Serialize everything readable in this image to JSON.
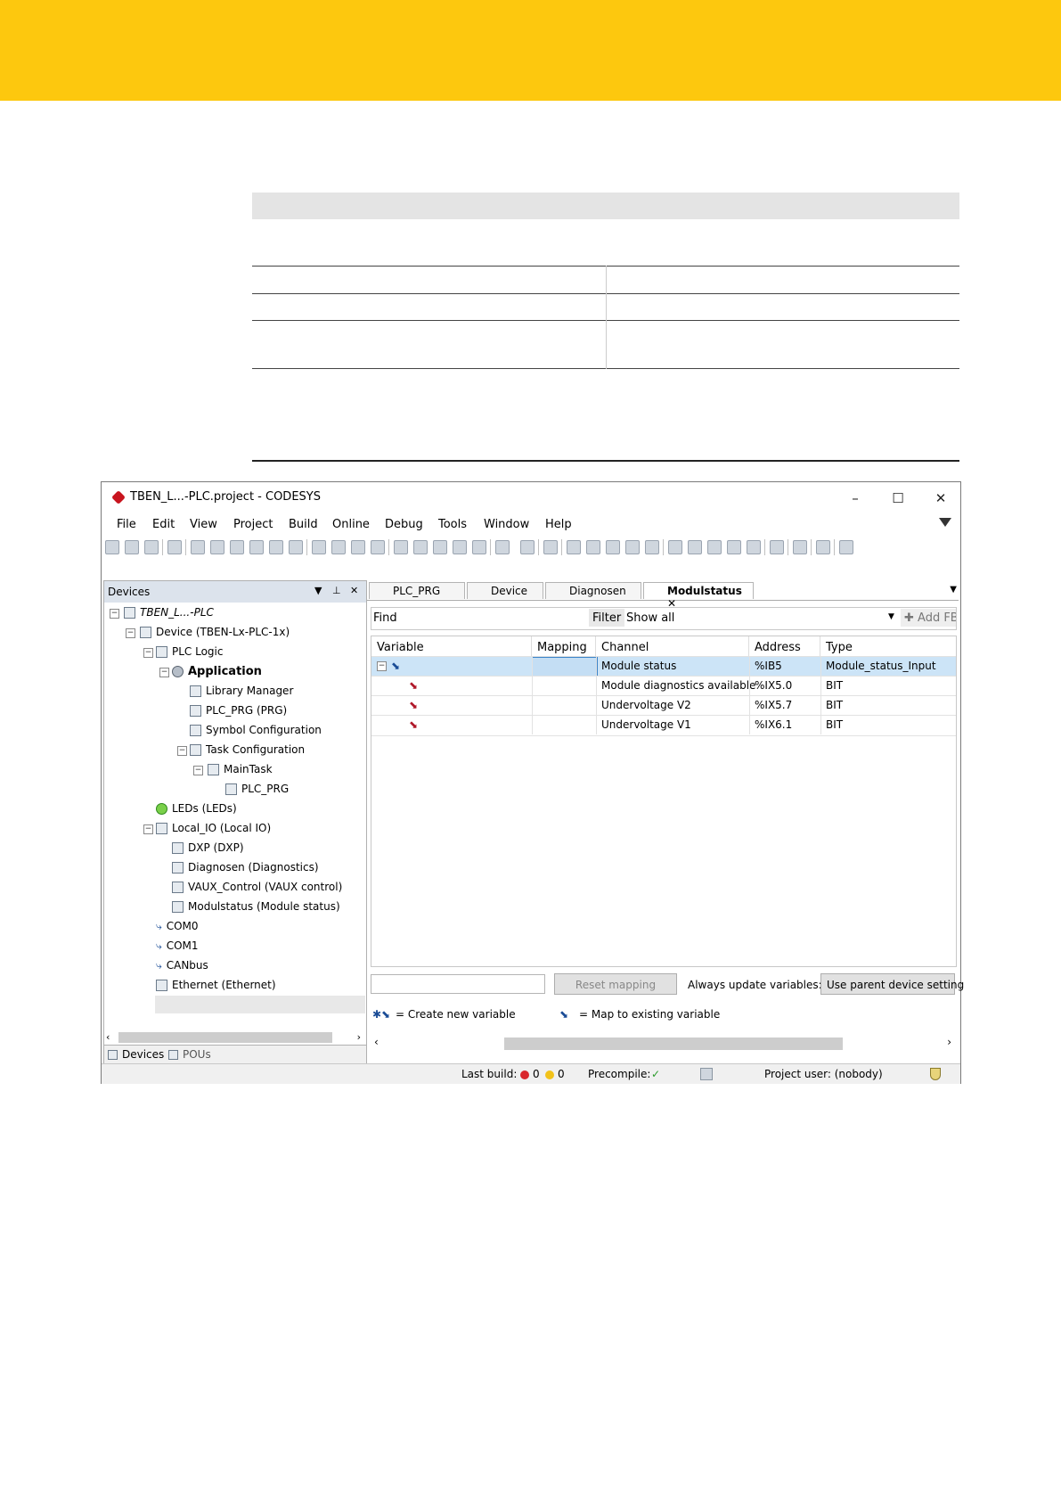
{
  "window": {
    "title": "TBEN_L...-PLC.project - CODESYS",
    "minimize": "–",
    "maximize": "☐",
    "close": "✕"
  },
  "menu": [
    "File",
    "Edit",
    "View",
    "Project",
    "Build",
    "Online",
    "Debug",
    "Tools",
    "Window",
    "Help"
  ],
  "devices_pane": {
    "title": "Devices",
    "tree": [
      {
        "label": "TBEN_L...-PLC",
        "italic": true
      },
      {
        "label": "Device (TBEN-Lx-PLC-1x)"
      },
      {
        "label": "PLC Logic"
      },
      {
        "label": "Application",
        "bold": true
      },
      {
        "label": "Library Manager"
      },
      {
        "label": "PLC_PRG (PRG)"
      },
      {
        "label": "Symbol Configuration"
      },
      {
        "label": "Task Configuration"
      },
      {
        "label": "MainTask"
      },
      {
        "label": "PLC_PRG"
      },
      {
        "label": "LEDs (LEDs)"
      },
      {
        "label": "Local_IO (Local IO)"
      },
      {
        "label": "DXP (DXP)"
      },
      {
        "label": "Diagnosen (Diagnostics)"
      },
      {
        "label": "VAUX_Control (VAUX control)"
      },
      {
        "label": "Modulstatus (Module status)",
        "selected": true
      },
      {
        "label": "COM0"
      },
      {
        "label": "COM1"
      },
      {
        "label": "CANbus"
      },
      {
        "label": "Ethernet (Ethernet)"
      }
    ],
    "bottom_tabs": [
      "Devices",
      "POUs"
    ]
  },
  "editor": {
    "tabs": [
      "PLC_PRG",
      "Device",
      "Diagnosen",
      "Modulstatus"
    ],
    "active_tab": "Modulstatus",
    "find_label": "Find",
    "filter_label": "Filter",
    "filter_value": "Show all",
    "add_label": "Add FB",
    "columns": [
      "Variable",
      "Mapping",
      "Channel",
      "Address",
      "Type"
    ],
    "rows": [
      {
        "channel": "Module status",
        "address": "%IB5",
        "type": "Module_status_Input"
      },
      {
        "channel": "Module diagnostics available",
        "address": "%IX5.0",
        "type": "BIT"
      },
      {
        "channel": "Undervoltage V2",
        "address": "%IX5.7",
        "type": "BIT"
      },
      {
        "channel": "Undervoltage V1",
        "address": "%IX6.1",
        "type": "BIT"
      }
    ],
    "reset_mapping": "Reset mapping",
    "always_update_label": "Always update variables:",
    "always_update_value": "Use parent device setting",
    "legend_create": "= Create new variable",
    "legend_map": "= Map to existing variable"
  },
  "statusbar": {
    "last_build": "Last build:",
    "errors": "0",
    "warnings": "0",
    "precompile": "Precompile:",
    "project_user": "Project user: (nobody)"
  },
  "colors": {
    "banner": "#fdc80e",
    "selection": "#cce4f7"
  }
}
